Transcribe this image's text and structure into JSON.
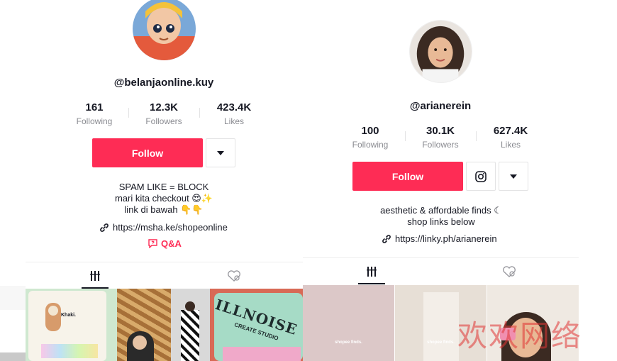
{
  "left_profile": {
    "username": "@belanjaonline.kuy",
    "stats": [
      {
        "value": "161",
        "label": "Following"
      },
      {
        "value": "12.3K",
        "label": "Followers"
      },
      {
        "value": "423.4K",
        "label": "Likes"
      }
    ],
    "follow_label": "Follow",
    "bio_lines": [
      "SPAM LIKE = BLOCK",
      "mari kita checkout 😍✨",
      "link di bawah 👇👇"
    ],
    "link": "https://msha.ke/shopeonline",
    "qa_label": "Q&A",
    "thumb_texts": [
      "Khaki.",
      "ILLNOISE",
      "CREATE STUDIO"
    ]
  },
  "right_profile": {
    "username": "@arianerein",
    "stats": [
      {
        "value": "100",
        "label": "Following"
      },
      {
        "value": "30.1K",
        "label": "Followers"
      },
      {
        "value": "627.4K",
        "label": "Likes"
      }
    ],
    "follow_label": "Follow",
    "bio_lines": [
      "aesthetic & affordable finds ☾",
      "shop links below"
    ],
    "link": "https://linky.ph/arianerein",
    "thumb_texts": [
      "shopee finds.",
      "shopee finds."
    ]
  },
  "watermark": "欢欢网络",
  "colors": {
    "accent": "#fe2c55",
    "text": "#161823",
    "muted": "#8a8b91"
  },
  "icons": [
    "link-icon",
    "qa-icon",
    "videos-tab-icon",
    "liked-tab-icon",
    "instagram-icon",
    "caret-down-icon"
  ]
}
